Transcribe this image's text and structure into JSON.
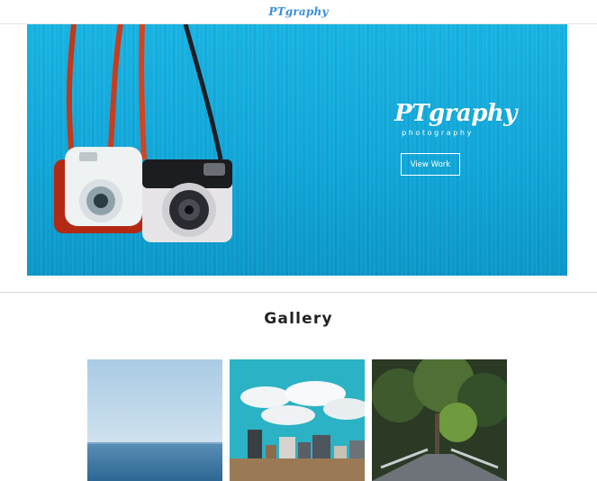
{
  "nav": {
    "brand": "PTgraphy"
  },
  "hero": {
    "title": "PTgraphy",
    "subtitle": "photography",
    "button_label": "View Work"
  },
  "gallery": {
    "heading": "Gallery",
    "items": [
      {
        "subject": "sea-horizon"
      },
      {
        "subject": "city-skyline"
      },
      {
        "subject": "forest-bridge"
      }
    ]
  },
  "colors": {
    "brand_blue": "#3a8ed8",
    "hero_blue": "#12aede",
    "text_dark": "#222222"
  }
}
